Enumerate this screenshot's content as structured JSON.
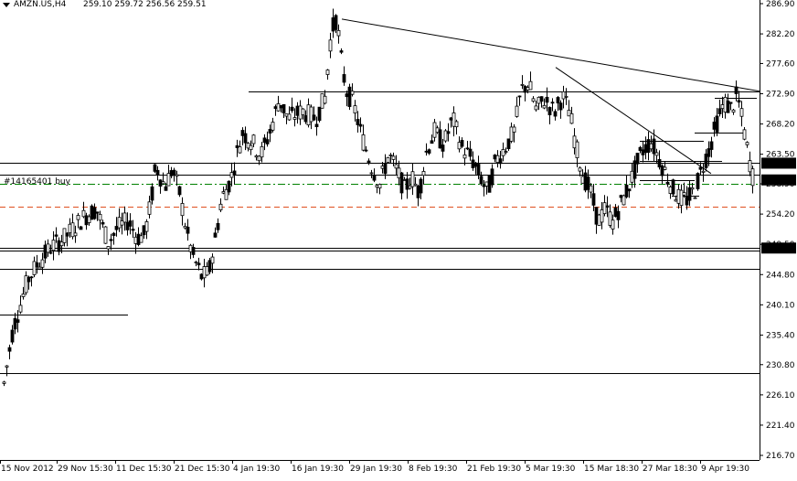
{
  "header": {
    "symbol": "AMZN.US,H4",
    "ohlc": "259.10 259.72 256.56 259.51",
    "menu_arrow": "dropdown-triangle"
  },
  "order": {
    "label": "#14165401 buy"
  },
  "price_tags": [
    {
      "text": "262.11",
      "value": 262.11
    },
    {
      "text": "259.51",
      "value": 259.51
    },
    {
      "text": "248.92",
      "value": 248.92
    }
  ],
  "colors": {
    "background": "#ffffff",
    "candle": "#000000",
    "grid": "#c8c8c8",
    "buy_line": "#008000",
    "sl_line": "#e05020",
    "price_tag_bg": "#000000",
    "price_tag_fg": "#ffffff"
  },
  "chart_data": {
    "type": "candlestick",
    "title": "AMZN.US,H4",
    "y_ticks": [
      "286.90",
      "282.20",
      "277.60",
      "272.90",
      "268.20",
      "263.50",
      "258.90",
      "254.20",
      "249.50",
      "244.80",
      "240.10",
      "235.40",
      "230.80",
      "226.10",
      "221.40",
      "216.70"
    ],
    "y_range": [
      215.0,
      288.0
    ],
    "x_ticks": [
      "15 Nov 2012",
      "29 Nov 15:30",
      "11 Dec 15:30",
      "21 Dec 15:30",
      "4 Jan 19:30",
      "16 Jan 19:30",
      "29 Jan 19:30",
      "8 Feb 19:30",
      "21 Feb 19:30",
      "5 Mar 19:30",
      "15 Mar 18:30",
      "27 Mar 18:30",
      "9 Apr 19:30"
    ],
    "horizontal_levels": [
      {
        "name": "level-273",
        "value": 273.3,
        "style": "solid"
      },
      {
        "name": "level-262",
        "value": 262.11,
        "style": "solid"
      },
      {
        "name": "level-260",
        "value": 260.3,
        "style": "solid"
      },
      {
        "name": "level-248.9",
        "value": 248.92,
        "style": "solid"
      },
      {
        "name": "level-248.6",
        "value": 248.6,
        "style": "solid"
      },
      {
        "name": "level-245.7",
        "value": 245.7,
        "style": "solid"
      },
      {
        "name": "level-238.6",
        "value": 238.6,
        "style": "solid"
      },
      {
        "name": "level-229.5",
        "value": 229.5,
        "style": "solid"
      },
      {
        "name": "order-buy",
        "value": 258.9,
        "style": "dashdot"
      },
      {
        "name": "stop-loss",
        "value": 255.3,
        "style": "dash"
      }
    ],
    "trendlines": [
      {
        "name": "upper-trendline",
        "x1": "17 Jan 2013",
        "y1": 284.5,
        "x2": "15 Apr 2013",
        "y2": 273.3
      },
      {
        "name": "inner-trendline",
        "x1": "6 Mar 2013",
        "y1": 277.0,
        "x2": "1 Apr 2013",
        "y2": 260.5
      }
    ],
    "ohlc_path": [
      [
        0,
        219.5
      ],
      [
        3,
        227.0
      ],
      [
        8,
        231.5
      ],
      [
        14,
        236.5
      ],
      [
        22,
        240.2
      ],
      [
        30,
        244.0
      ],
      [
        40,
        246.3
      ],
      [
        55,
        249.0
      ],
      [
        70,
        250.5
      ],
      [
        90,
        253.6
      ],
      [
        105,
        255.0
      ],
      [
        118,
        249.8
      ],
      [
        128,
        252.0
      ],
      [
        140,
        253.2
      ],
      [
        150,
        250.5
      ],
      [
        158,
        251.0
      ],
      [
        165,
        256.3
      ],
      [
        170,
        261.7
      ],
      [
        180,
        258.4
      ],
      [
        188,
        261.2
      ],
      [
        196,
        257.5
      ],
      [
        203,
        252.0
      ],
      [
        210,
        247.9
      ],
      [
        220,
        244.5
      ],
      [
        228,
        245.0
      ],
      [
        236,
        251.0
      ],
      [
        242,
        256.6
      ],
      [
        252,
        259.5
      ],
      [
        258,
        263.2
      ],
      [
        265,
        266.8
      ],
      [
        275,
        265.5
      ],
      [
        285,
        263.3
      ],
      [
        295,
        267.0
      ],
      [
        305,
        272.0
      ],
      [
        315,
        269.0
      ],
      [
        330,
        270.2
      ],
      [
        345,
        269.0
      ],
      [
        355,
        272.3
      ],
      [
        362,
        282.5
      ],
      [
        368,
        284.8
      ],
      [
        372,
        279.0
      ],
      [
        378,
        273.5
      ],
      [
        386,
        271.5
      ],
      [
        395,
        266.5
      ],
      [
        405,
        262.0
      ],
      [
        415,
        258.8
      ],
      [
        425,
        263.5
      ],
      [
        435,
        260.5
      ],
      [
        442,
        258.0
      ],
      [
        450,
        260.0
      ],
      [
        458,
        257.5
      ],
      [
        466,
        263.8
      ],
      [
        475,
        267.0
      ],
      [
        485,
        265.0
      ],
      [
        495,
        269.0
      ],
      [
        505,
        264.5
      ],
      [
        515,
        263.0
      ],
      [
        525,
        260.0
      ],
      [
        533,
        257.5
      ],
      [
        542,
        262.5
      ],
      [
        552,
        264.5
      ],
      [
        562,
        267.0
      ],
      [
        570,
        273.5
      ],
      [
        578,
        274.5
      ],
      [
        586,
        270.5
      ],
      [
        596,
        272.0
      ],
      [
        606,
        270.0
      ],
      [
        615,
        272.5
      ],
      [
        623,
        270.0
      ],
      [
        630,
        264.5
      ],
      [
        638,
        260.0
      ],
      [
        646,
        257.5
      ],
      [
        654,
        253.0
      ],
      [
        662,
        255.0
      ],
      [
        670,
        253.0
      ],
      [
        678,
        255.5
      ],
      [
        686,
        258.0
      ],
      [
        694,
        261.0
      ],
      [
        702,
        264.0
      ],
      [
        712,
        265.5
      ],
      [
        720,
        263.0
      ],
      [
        728,
        260.5
      ],
      [
        736,
        258.0
      ],
      [
        744,
        256.5
      ],
      [
        752,
        256.5
      ],
      [
        760,
        258.0
      ],
      [
        768,
        261.5
      ],
      [
        776,
        264.5
      ],
      [
        784,
        268.5
      ],
      [
        792,
        271.5
      ],
      [
        800,
        270.5
      ],
      [
        806,
        272.8
      ],
      [
        812,
        268.5
      ],
      [
        818,
        263.5
      ],
      [
        824,
        259.5
      ]
    ]
  }
}
